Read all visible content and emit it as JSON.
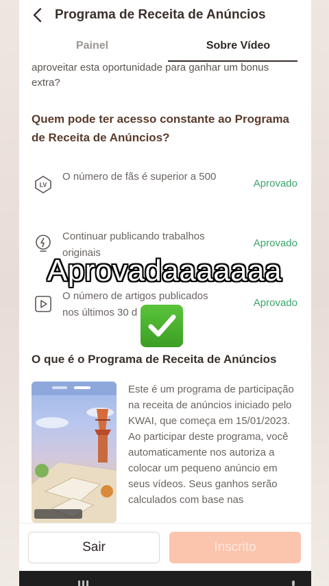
{
  "header": {
    "title": "Programa de Receita de Anúncios"
  },
  "tabs": [
    {
      "label": "Painel"
    },
    {
      "label": "Sobre Vídeo"
    }
  ],
  "intro_text": "aproveitar esta oportunidade para ganhar um bonus extra?",
  "question": "Quem pode ter acesso constante ao Programa de Receita de Anúncios?",
  "requirements": [
    {
      "text": "O número de fãs é superior a 500",
      "status": "Aprovado",
      "icon": "lv-badge-icon"
    },
    {
      "text": "Continuar publicando trabalhos originais",
      "status": "Aprovado",
      "icon": "lightbulb-icon"
    },
    {
      "text": "O número de artigos publicados nos últimos 30 d",
      "status": "Aprovado",
      "icon": "play-video-icon"
    }
  ],
  "overlay": {
    "caption": "Aprovadaaaaaaa",
    "emoji": "check-mark-icon"
  },
  "about": {
    "title": "O que é o Programa de Receita de Anúncios",
    "description": "Este é um programa de participação na receita de anúncios iniciado pelo KWAI, que começa em 15/01/2023. Ao participar deste programa, você automaticamente nos autoriza a colocar um pequeno anúncio em seus vídeos. Seus ganhos serão calculados com base nas"
  },
  "buttons": {
    "exit": "Sair",
    "subscribed": "Inscrito"
  },
  "colors": {
    "approved": "#3aa36b",
    "accent_disabled": "#fbc4ad",
    "question": "#5a3b2c"
  }
}
